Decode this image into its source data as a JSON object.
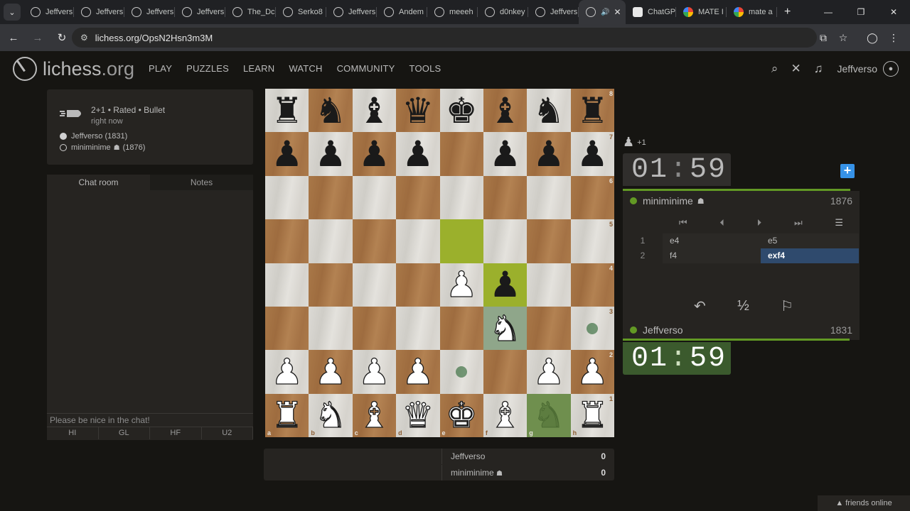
{
  "browser": {
    "menu_icon": "chevron-down-icon",
    "tabs": [
      {
        "title": "Jeffvers",
        "fav": "lichess"
      },
      {
        "title": "Jeffvers",
        "fav": "lichess"
      },
      {
        "title": "Jeffvers",
        "fav": "lichess"
      },
      {
        "title": "Jeffvers",
        "fav": "lichess"
      },
      {
        "title": "The_Dc",
        "fav": "lichess"
      },
      {
        "title": "Serko8",
        "fav": "lichess"
      },
      {
        "title": "Jeffvers",
        "fav": "lichess"
      },
      {
        "title": "Andem",
        "fav": "lichess"
      },
      {
        "title": "meeeh",
        "fav": "lichess"
      },
      {
        "title": "d0nkey",
        "fav": "lichess"
      },
      {
        "title": "Jeffvers",
        "fav": "lichess"
      },
      {
        "title": "",
        "fav": "lichess",
        "active": true
      },
      {
        "title": "ChatGP",
        "fav": "chatgpt"
      },
      {
        "title": "MATE I",
        "fav": "google"
      },
      {
        "title": "mate a",
        "fav": "google"
      }
    ],
    "url": "lichess.org/OpsN2Hsn3m3M"
  },
  "site": {
    "logo_main": "lichess",
    "logo_tld": ".org",
    "nav": [
      "PLAY",
      "PUZZLES",
      "LEARN",
      "WATCH",
      "COMMUNITY",
      "TOOLS"
    ],
    "username": "Jeffverso"
  },
  "game": {
    "mode": "2+1 • Rated • Bullet",
    "time": "right now",
    "white_player": "Jeffverso (1831)",
    "black_player": "miniminime",
    "black_rating_paren": "(1876)"
  },
  "chat": {
    "tabs": [
      "Chat room",
      "Notes"
    ],
    "placeholder": "Please be nice in the chat!",
    "quick": [
      "HI",
      "GL",
      "HF",
      "U2"
    ]
  },
  "board": {
    "ranks": [
      "8",
      "7",
      "6",
      "5",
      "4",
      "3",
      "2",
      "1"
    ],
    "files": [
      "a",
      "b",
      "c",
      "d",
      "e",
      "f",
      "g",
      "h"
    ],
    "position": [
      [
        "bR",
        "bN",
        "bB",
        "bQ",
        "bK",
        "bB",
        "bN",
        "bR"
      ],
      [
        "bP",
        "bP",
        "bP",
        "bP",
        "",
        "bP",
        "bP",
        "bP"
      ],
      [
        "",
        "",
        "",
        "",
        "",
        "",
        "",
        ""
      ],
      [
        "",
        "",
        "",
        "",
        "",
        "",
        "",
        ""
      ],
      [
        "",
        "",
        "",
        "",
        "wP",
        "bP",
        "",
        ""
      ],
      [
        "",
        "",
        "",
        "",
        "",
        "wN",
        "",
        ""
      ],
      [
        "wP",
        "wP",
        "wP",
        "wP",
        "",
        "",
        "wP",
        "wP"
      ],
      [
        "wR",
        "wN",
        "wB",
        "wQ",
        "wK",
        "wB",
        "gN",
        "wR"
      ]
    ],
    "last_move": [
      "e5",
      "f4"
    ],
    "selected": "f3",
    "origin": "g1",
    "move_dots": [
      "h3",
      "e2"
    ]
  },
  "crosstable": [
    {
      "name": "Jeffverso",
      "score": "0"
    },
    {
      "name": "miniminime",
      "score": "0"
    }
  ],
  "right": {
    "material_diff": "+1",
    "opp_clock_min": "01",
    "opp_clock_sec": "59",
    "opp_name": "miniminime",
    "opp_rating": "1876",
    "moves": [
      {
        "no": "1",
        "white": "e4",
        "black": "e5"
      },
      {
        "no": "2",
        "white": "f4",
        "black": "exf4"
      }
    ],
    "my_name": "Jeffverso",
    "my_rating": "1831",
    "my_clock_min": "01",
    "my_clock_sec": "59",
    "draw_symbol": "½"
  },
  "footer": {
    "friends": "▲ friends online"
  }
}
